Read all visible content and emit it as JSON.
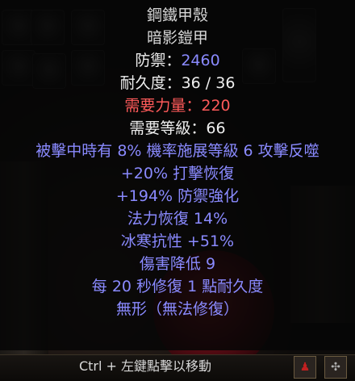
{
  "item": {
    "name": "鋼鐵甲殼",
    "base": "暗影鎧甲",
    "defense_label": "防禦：",
    "defense_value": "2460",
    "durability": "耐久度：36 / 36",
    "req_str_label": "需要力量：",
    "req_str_value": "220",
    "req_level": "需要等級：66",
    "mods": [
      "被擊中時有 8% 機率施展等級 6 攻擊反噬",
      "+20% 打擊恢復",
      "+194% 防禦強化",
      "法力恢復 14%",
      "冰寒抗性 +51%",
      "傷害降低 9",
      "每 20 秒修復 1 點耐久度",
      "無形（無法修復）"
    ]
  },
  "status_bar": {
    "hint": "Ctrl + 左鍵點擊以移動"
  },
  "colors": {
    "white_text": "#efefef",
    "magic_blue": "#8a8aff",
    "requirement_red": "#ff5a5a"
  }
}
